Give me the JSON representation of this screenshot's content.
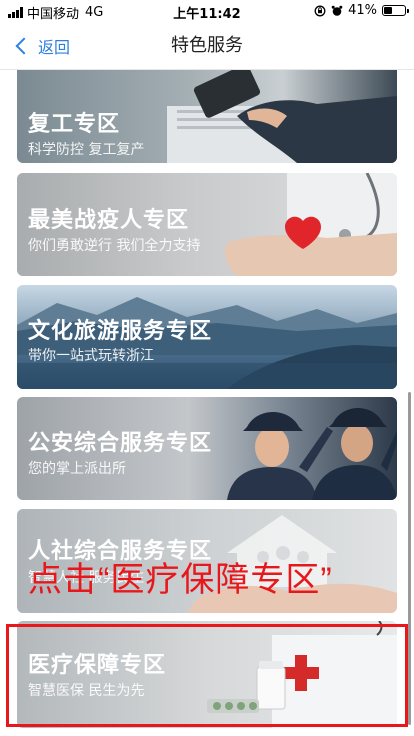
{
  "status_bar": {
    "carrier": "中国移动",
    "network": "4G",
    "time": "上午11:42",
    "battery": "41%",
    "battery_level": 0.41
  },
  "nav": {
    "back_label": "返回",
    "title": "特色服务"
  },
  "cards": [
    {
      "title": "复工专区",
      "subtitle": "科学防控 复工复产"
    },
    {
      "title": "最美战疫人专区",
      "subtitle": "你们勇敢逆行 我们全力支持"
    },
    {
      "title": "文化旅游服务专区",
      "subtitle": "带你一站式玩转浙江"
    },
    {
      "title": "公安综合服务专区",
      "subtitle": "您的掌上派出所"
    },
    {
      "title": "人社综合服务专区",
      "subtitle": "智慧人社 服务民生"
    },
    {
      "title": "医疗保障专区",
      "subtitle": "智慧医保 民生为先"
    }
  ],
  "annotation": {
    "text": "点击“医疗保障专区”"
  },
  "colors": {
    "accent": "#2c7fe3",
    "annotation": "#e8171b",
    "first_aid": "#d42a2a"
  }
}
